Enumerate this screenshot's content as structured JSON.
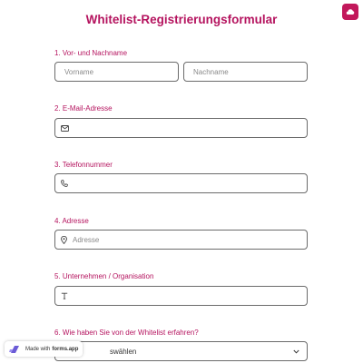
{
  "form": {
    "title": "Whitelist-Registrierungsformular"
  },
  "colors": {
    "accent": "#b5145f",
    "button": "#c2185b",
    "border": "#6b6b6b"
  },
  "header": {
    "save_icon": "cloud-icon"
  },
  "questions": {
    "name": {
      "label": "1.  Vor- und Nachname",
      "first_placeholder": "Vorname",
      "last_placeholder": "Nachname"
    },
    "email": {
      "label": "2.  E-Mail-Adresse",
      "icon": "mail-icon",
      "placeholder": ""
    },
    "phone": {
      "label": "3.  Telefonnummer",
      "icon": "phone-icon",
      "placeholder": ""
    },
    "address": {
      "label": "4.  Adresse",
      "icon": "map-pin-icon",
      "placeholder": "Adresse"
    },
    "company": {
      "label": "5.  Unternehmen / Organisation",
      "icon": "text-icon",
      "placeholder": ""
    },
    "source": {
      "label": "6.  Wie haben Sie von der Whitelist erfahren?",
      "selected": "swählen",
      "icon": "chevron-down-icon"
    }
  },
  "badge": {
    "prefix": "Made with",
    "brand": "forms.app"
  }
}
